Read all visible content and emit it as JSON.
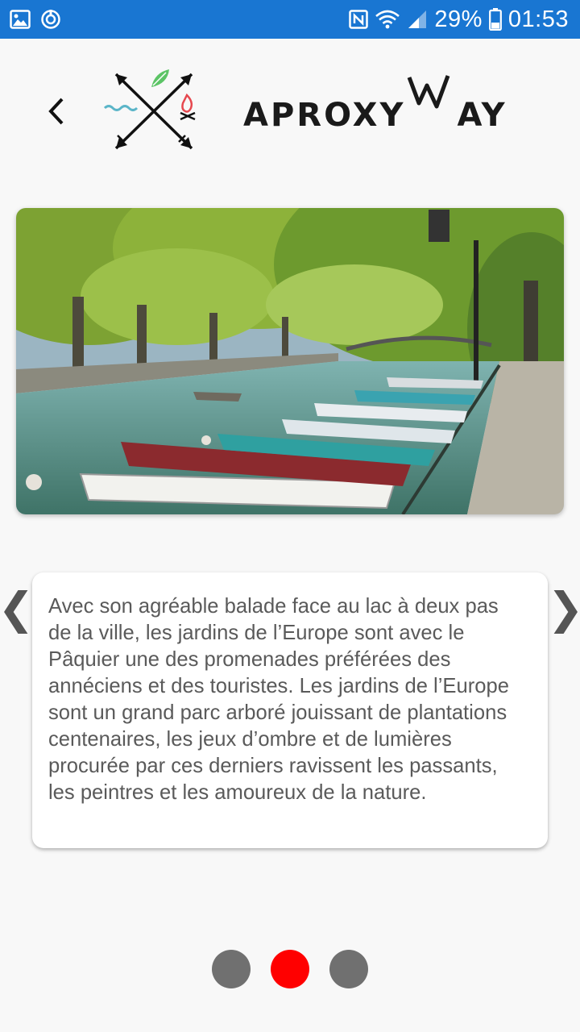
{
  "status_bar": {
    "icons": [
      "image-icon",
      "sync-icon",
      "nfc-icon",
      "wifi-icon",
      "signal-icon",
      "battery-icon"
    ],
    "battery": "29%",
    "time": "01:53",
    "color": "#1976d2"
  },
  "header": {
    "back_icon": "chevron-left-icon",
    "brand": "APROXYWAY",
    "brand_left": "APROXY",
    "brand_mid": "W",
    "brand_right": "AY"
  },
  "slide": {
    "image": "lakeside-canal-boats-photo",
    "description": "Avec son agréable balade face au lac à deux pas de la ville, les jardins de l’Europe sont avec le Pâquier une des promenades préférées des annéciens et des touristes. Les jardins de l’Europe sont un grand parc arboré jouissant de plantations centenaires, les jeux d’ombre et de lumières procurée par ces derniers ravissent les passants, les peintres et les amoureux de la nature.",
    "prev_label": "❮",
    "next_label": "❯"
  },
  "pagination": {
    "count": 3,
    "active_index": 1,
    "active_color": "#ff0000",
    "inactive_color": "#707070"
  }
}
